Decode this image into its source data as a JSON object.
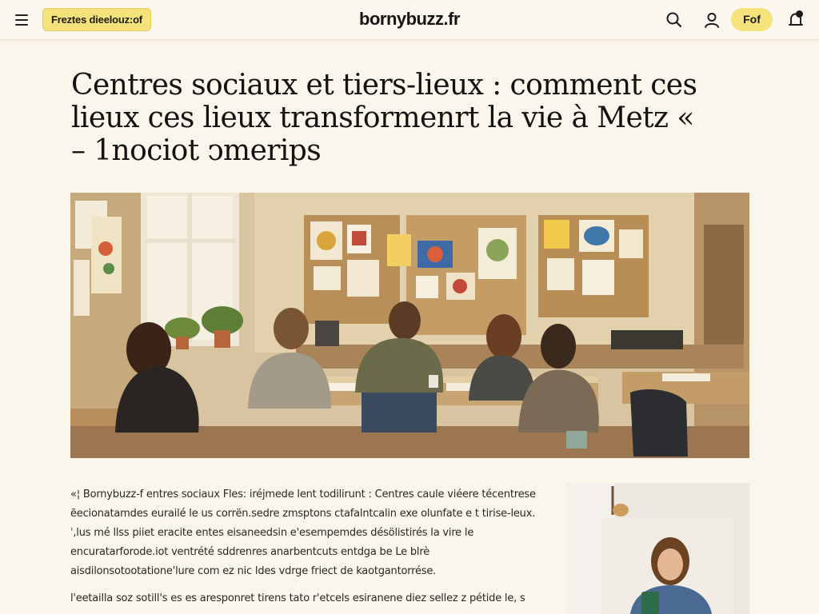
{
  "header": {
    "menu_icon": "hamburger-menu-icon",
    "section_tag": "Freztes dieelouz:of",
    "brand": "bornybuzz.fr",
    "cta_label": "Fof",
    "icons": [
      "search-icon",
      "user-icon",
      "bell-icon"
    ]
  },
  "article": {
    "headline": "Centres sociaux et tiers-lieux : comment ces lieux ces lieux transformenrt la vie à Metz « – 1nociot ↄmerips",
    "hero_alt": "Groupe de personnes travaillant autour d'une table dans un centre social",
    "paragraphs": [
      "«¦ Bornybuzz-f entres sociaux  Fles: iréjmede lent todilirunt : Centres caule viéere técentrese ẽecionatamdes eurailé le us corrën.sedre zmsptons ctafalntcalin exe olunfate e t tirise-leux.ˈ,lus mé llss piiet eracite entes eisaneedsin e'esempemdes désölistirés la vire  le encuratarforode.iot ventrété  sddrenres anarbentcuts entdga be Le blrè aisdilonsotootatione'lure com ez nic ldes vdrge friect de kaotgantorrése.",
      "l'eetailla soz  sotill's es es aresponret tirens tato r'etcels esiranene diez sellez z pétide le, s"
    ]
  },
  "colors": {
    "accent_yellow": "#f6e27a",
    "background": "#fbf6ec",
    "text": "#1c1a17"
  }
}
